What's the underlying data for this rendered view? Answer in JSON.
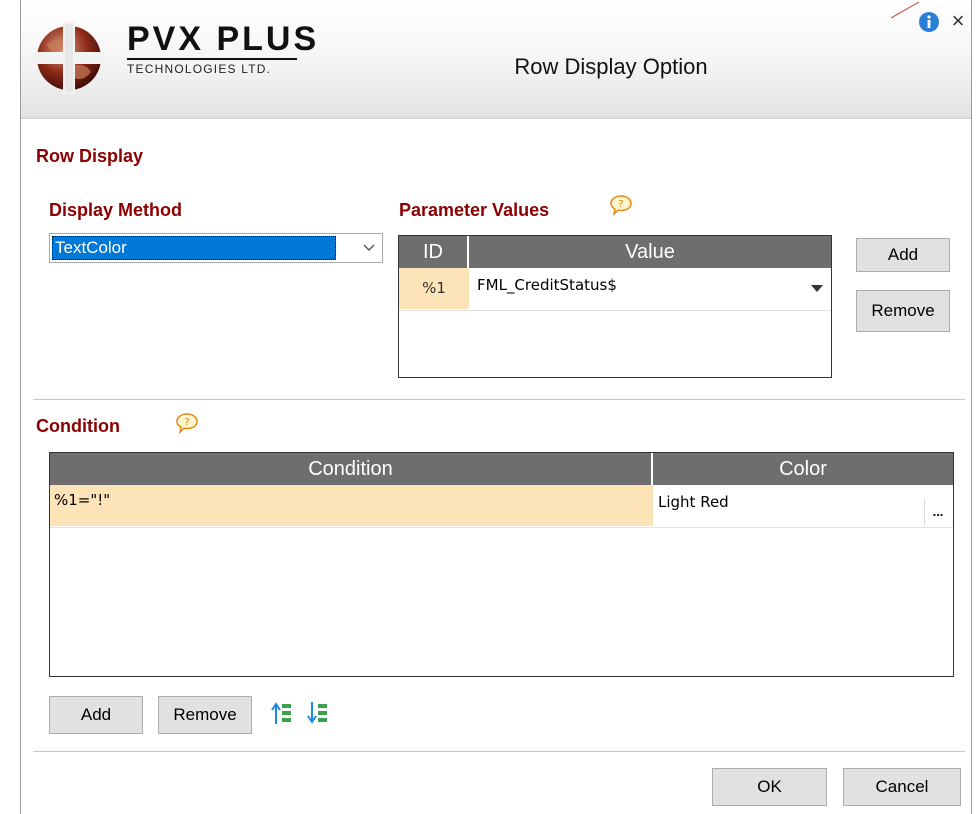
{
  "window": {
    "title": "Row Display Option",
    "logo_main": "PVX PLUS",
    "logo_sub": "TECHNOLOGIES LTD.",
    "close_glyph": "×"
  },
  "row_display": {
    "section_title": "Row Display",
    "display_method_label": "Display Method",
    "display_method_value": "TextColor",
    "parameter_values_label": "Parameter Values",
    "param_columns": [
      "ID",
      "Value"
    ],
    "param_rows": [
      {
        "id": "%1",
        "value": "FML_CreditStatus$"
      }
    ],
    "add_label": "Add",
    "remove_label": "Remove"
  },
  "condition": {
    "section_title": "Condition",
    "columns": [
      "Condition",
      "Color"
    ],
    "rows": [
      {
        "condition": "%1=\"!\"",
        "color": "Light Red",
        "ellipsis": "..."
      }
    ],
    "add_label": "Add",
    "remove_label": "Remove"
  },
  "footer": {
    "ok_label": "OK",
    "cancel_label": "Cancel"
  },
  "icons": [
    "globe-logo-icon",
    "info-icon",
    "close-icon",
    "help-bubble-icon",
    "chevron-down-icon",
    "dropdown-arrow-icon",
    "move-up-icon",
    "move-down-icon"
  ],
  "colors": {
    "accent_title": "#8b0000",
    "grid_header": "#6e6e6e",
    "highlight_row": "#fde3b8",
    "selection": "#0078d7"
  }
}
